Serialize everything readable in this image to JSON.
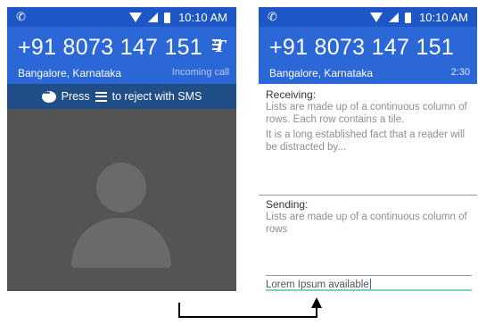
{
  "colors": {
    "status_bar": "#1d56c7",
    "header": "#2b67d6",
    "reject_bar": "#1f4f86",
    "call_background": "#545454",
    "input_underline": "#7fcfc9"
  },
  "left_screen": {
    "status_bar": {
      "call_icon": "phone-call-icon",
      "time": "10:10 AM"
    },
    "caller": {
      "number": "+91 8073 147 151",
      "location": "Bangalore, Karnataka",
      "status": "Incoming call",
      "rtt_icon": "rtt-icon"
    },
    "reject_bar": {
      "press_label": "Press",
      "message_label": "to reject with SMS"
    }
  },
  "right_screen": {
    "status_bar": {
      "call_icon": "phone-call-icon",
      "time": "10:10 AM"
    },
    "caller": {
      "number": "+91 8073 147 151",
      "location": "Bangalore, Karnataka",
      "duration": "2:30"
    },
    "receiving": {
      "label": "Receiving:",
      "text_1": "Lists are made up of a continuous column of rows. Each row contains a tile.",
      "text_2": "It is a long established fact that a reader will be distracted by..."
    },
    "sending": {
      "label": "Sending:",
      "text": "Lists are made up of a continuous column of rows"
    },
    "input": {
      "value": "Lorem Ipsum available"
    }
  }
}
